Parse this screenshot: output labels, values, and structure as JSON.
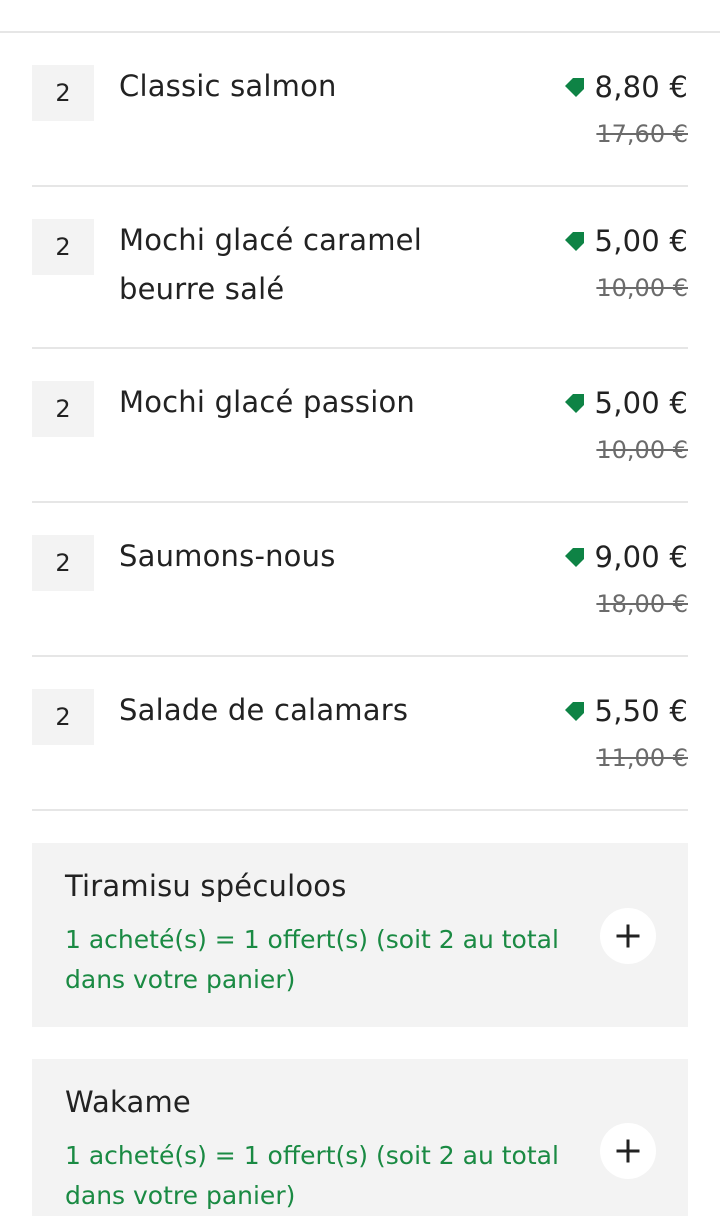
{
  "colors": {
    "discount_green": "#0e8345",
    "promo_text_green": "#1a8a43",
    "card_background": "#f3f3f3",
    "divider": "#e6e6e6"
  },
  "cart_items": [
    {
      "quantity": "2",
      "name": "Classic salmon",
      "price": "8,80 €",
      "original_price": "17,60 €",
      "icon": "discount-tag-icon"
    },
    {
      "quantity": "2",
      "name": "Mochi glacé caramel beurre salé",
      "price": "5,00 €",
      "original_price": "10,00 €",
      "icon": "discount-tag-icon"
    },
    {
      "quantity": "2",
      "name": "Mochi glacé passion",
      "price": "5,00 €",
      "original_price": "10,00 €",
      "icon": "discount-tag-icon"
    },
    {
      "quantity": "2",
      "name": "Saumons-nous",
      "price": "9,00 €",
      "original_price": "18,00 €",
      "icon": "discount-tag-icon"
    },
    {
      "quantity": "2",
      "name": "Salade de calamars",
      "price": "5,50 €",
      "original_price": "11,00 €",
      "icon": "discount-tag-icon"
    }
  ],
  "promo_offers": [
    {
      "title": "Tiramisu spéculoos",
      "description": "1 acheté(s) = 1 offert(s) (soit 2 au total dans votre panier)",
      "icon": "plus-icon"
    },
    {
      "title": "Wakame",
      "description": "1 acheté(s) = 1 offert(s) (soit 2 au total dans votre panier)",
      "icon": "plus-icon"
    }
  ]
}
